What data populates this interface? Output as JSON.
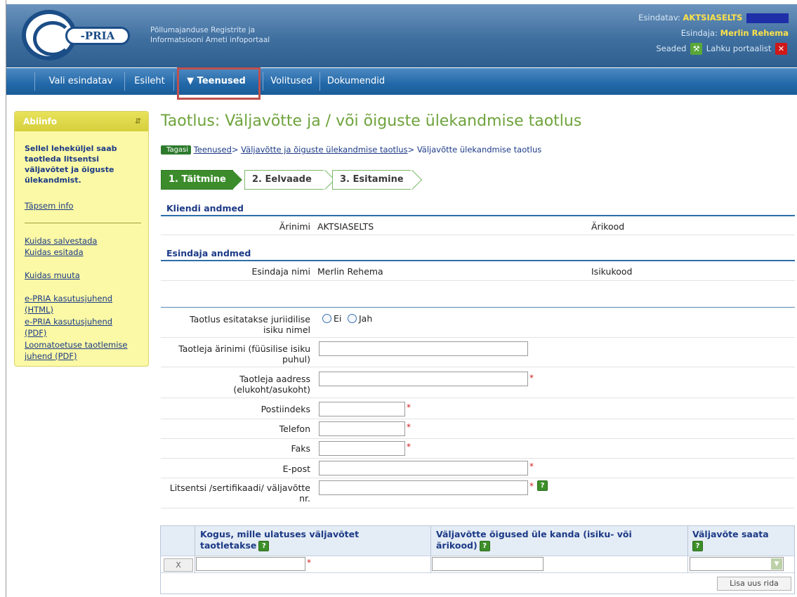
{
  "header": {
    "logo_text": "-PRIA",
    "portal_name_line1": "Põllumajanduse Registrite ja",
    "portal_name_line2": "Informatsiooni Ameti infoportaal",
    "represented_label": "Esindatav:",
    "represented_value": "AKTSIASELTS",
    "representative_label": "Esindaja:",
    "representative_value": "Merlin Rehema",
    "settings_label": "Seaded",
    "logout_label": "Lahku portaalist"
  },
  "nav": {
    "items": [
      {
        "label": "Vali esindatav"
      },
      {
        "label": "Esileht"
      },
      {
        "label": "▼ Teenused"
      },
      {
        "label": "Volitused"
      },
      {
        "label": "Dokumendid"
      }
    ]
  },
  "sidebar": {
    "title": "Abiinfo",
    "intro": "Sellel leheküljel saab taotleda litsentsi väljavõtet ja õiguste ülekandmist.",
    "links": [
      {
        "label": "Täpsem info"
      },
      {
        "label": "Kuidas salvestada"
      },
      {
        "label": "Kuidas esitada"
      },
      {
        "label": "Kuidas muuta"
      },
      {
        "label": "e-PRIA kasutusjuhend (HTML)"
      },
      {
        "label": "e-PRIA kasutusjuhend (PDF)"
      },
      {
        "label": "Loomatoetuse taotlemise juhend (PDF)"
      }
    ]
  },
  "main": {
    "title": "Taotlus: Väljavõtte ja / või õiguste ülekandmise taotlus",
    "back_label": "Tagasi",
    "breadcrumb": [
      {
        "label": "Teenused"
      },
      {
        "label": "Väljavõtte ja õiguste ülekandmise taotlus"
      },
      {
        "label": "Väljavõtte ülekandmise taotlus"
      }
    ],
    "steps": [
      {
        "label": "1. Täitmine"
      },
      {
        "label": "2. Eelvaade"
      },
      {
        "label": "3. Esitamine"
      }
    ],
    "client": {
      "section_title": "Kliendi andmed",
      "name_label": "Ärinimi",
      "name_value": "AKTSIASELTS",
      "code_label": "Ärikood"
    },
    "representative": {
      "section_title": "Esindaja andmed",
      "name_label": "Esindaja nimi",
      "name_value": "Merlin Rehema",
      "code_label": "Isikukood"
    },
    "form": {
      "legal_person_label_1": "Taotlus esitatakse juriidilise",
      "legal_person_label_2": "isiku nimel",
      "radio_no": "Ei",
      "radio_yes": "Jah",
      "business_name_label_1": "Taotleja ärinimi (füüsilise isiku",
      "business_name_label_2": "puhul)",
      "address_label_1": "Taotleja aadress",
      "address_label_2": "(elukoht/asukoht)",
      "postal_label": "Postiindeks",
      "phone_label": "Telefon",
      "fax_label": "Faks",
      "email_label": "E-post",
      "license_label_1": "Litsentsi /sertifikaadi/ väljavõtte",
      "license_label_2": "nr.",
      "required_mark": "*",
      "help_mark": "?"
    },
    "table": {
      "col1_line1": "Kogus, mille ulatuses väljavõtet",
      "col1_line2": "taotletakse",
      "col2_line1": "Väljavõtte õigused üle kanda (isiku- või",
      "col2_line2": "ärikood)",
      "col3_line1": "Väljavõte saata",
      "delete_label": "X",
      "add_row_label": "Lisa uus rida"
    }
  }
}
